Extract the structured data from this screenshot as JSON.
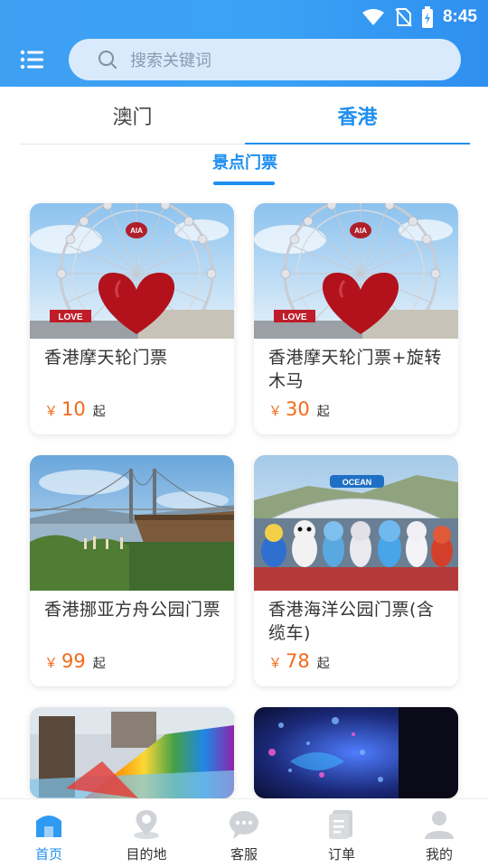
{
  "status": {
    "time": "8:45"
  },
  "search": {
    "placeholder": "搜索关键词"
  },
  "tabs": [
    {
      "label": "澳门",
      "active": false
    },
    {
      "label": "香港",
      "active": true
    }
  ],
  "subtab": {
    "label": "景点门票"
  },
  "cards": [
    {
      "title": "香港摩天轮门票",
      "yen": "￥",
      "price": "10",
      "suffix": "起",
      "image": "ferris-wheel-heart"
    },
    {
      "title": "香港摩天轮门票+旋转木马",
      "yen": "￥",
      "price": "30",
      "suffix": "起",
      "image": "ferris-wheel-heart"
    },
    {
      "title": "香港挪亚方舟公园门票",
      "yen": "￥",
      "price": "99",
      "suffix": "起",
      "image": "bridge-ark-park"
    },
    {
      "title": "香港海洋公园门票(含缆车)",
      "yen": "￥",
      "price": "78",
      "suffix": "起",
      "image": "ocean-park-mascots"
    },
    {
      "title": "",
      "yen": "",
      "price": "",
      "suffix": "",
      "image": "rainbow-water-slide"
    },
    {
      "title": "",
      "yen": "",
      "price": "",
      "suffix": "",
      "image": "underwater-light-show"
    }
  ],
  "bottom_nav": [
    {
      "label": "首页",
      "icon": "home-icon",
      "active": true
    },
    {
      "label": "目的地",
      "icon": "location-pin-icon",
      "active": false
    },
    {
      "label": "客服",
      "icon": "chat-icon",
      "active": false
    },
    {
      "label": "订单",
      "icon": "order-icon",
      "active": false
    },
    {
      "label": "我的",
      "icon": "user-icon",
      "active": false
    }
  ],
  "colors": {
    "accent": "#1f8ff0",
    "price": "#f26a1b",
    "header": "#3aa2f5"
  }
}
